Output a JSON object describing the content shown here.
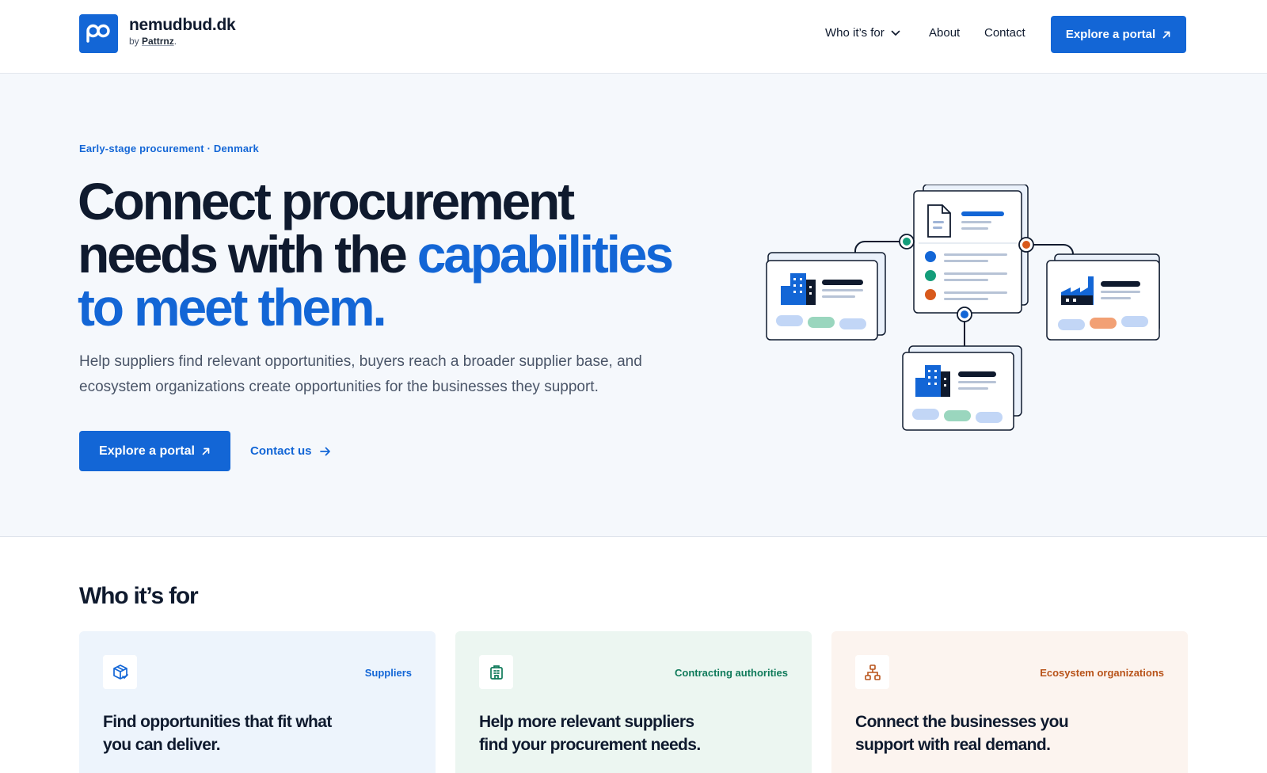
{
  "header": {
    "brand_name": "nemudbud.dk",
    "brand_by": "by",
    "brand_by_link": "Pattrnz",
    "brand_by_suffix": ".",
    "nav": {
      "who": "Who it’s for",
      "about": "About",
      "contact": "Contact"
    },
    "cta_label": "Explore a portal"
  },
  "hero": {
    "eyebrow": "Early-stage procurement · Denmark",
    "headline_line1": "Connect procurement",
    "headline_line2_a": "needs with the ",
    "headline_line2_accent": "capabilities",
    "headline_line3_accent": "to meet them",
    "headline_line3_period": ".",
    "subtext": "Help suppliers find relevant opportunities, buyers reach a broader supplier base, and ecosystem organizations create opportunities for the businesses they support.",
    "primary_cta": "Explore a portal",
    "secondary_cta": "Contact us"
  },
  "audience": {
    "title": "Who it’s for",
    "cards": [
      {
        "tag": "Suppliers",
        "title": "Find opportunities that fit what you can deliver.",
        "icon": "package-check-icon"
      },
      {
        "tag": "Contracting authorities",
        "title": "Help more relevant suppliers find your procurement needs.",
        "icon": "building-icon"
      },
      {
        "tag": "Ecosystem organizations",
        "title": "Connect the businesses you support with real demand.",
        "icon": "network-icon"
      }
    ]
  },
  "colors": {
    "primary": "#1366d6",
    "dark": "#0f1a2e",
    "green": "#149d7a",
    "orange": "#d8591c"
  }
}
